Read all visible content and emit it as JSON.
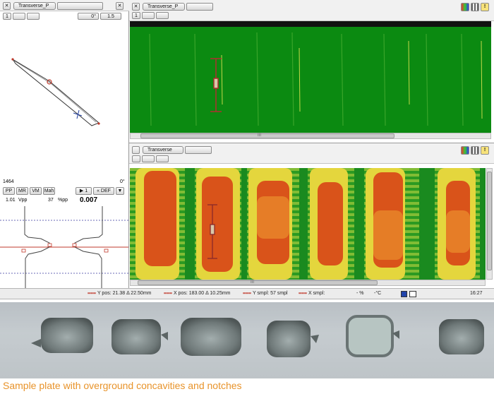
{
  "left_panel": {
    "tab_title": "Transverse_P",
    "close_glyph": "✕",
    "toolbar_row2": {
      "btn1": "1",
      "angle": "0°",
      "value": "1.5"
    },
    "bottom_left_value": "1464",
    "bottom_right_angle": "0°",
    "buttons": [
      "PP",
      "MR",
      "VM",
      "Mah"
    ],
    "play_button": "▶ 1",
    "def_button": "« DEF",
    "menu_glyph": "▼",
    "readout": {
      "vpp": "1.01",
      "vpp_unit": "Vpp",
      "pp_value": "37",
      "pp_unit": "%pp",
      "big_value": "0.007"
    }
  },
  "top_panel": {
    "tab_title": "Transverse_P",
    "close_glyph": "✕",
    "page_value": "1",
    "scroll_glyph": "III"
  },
  "bottom_panel": {
    "tab_title": "Transverse",
    "scroll_glyph": "III"
  },
  "window_icons": [
    "palette-icon",
    "grid-icon",
    "info-icon"
  ],
  "status_bar": {
    "y_pos": "Y pos: 21.38 Δ 22.50mm",
    "x_pos": "X pos: 183.00 Δ 10.25mm",
    "y_smpl": "Y smpl: 57 smpl",
    "x_smpl": "X smpl: ",
    "percent": "- %",
    "temperature": "-°C",
    "time": "16:27"
  },
  "caption": "Sample plate with overground concavities and notches",
  "colors": {
    "caption": "#e8932a",
    "cscan_green": "#0a8a12",
    "heat_orange": "#d9531a",
    "heat_yellow": "#e6d33a",
    "cursor_red": "#b03030"
  }
}
